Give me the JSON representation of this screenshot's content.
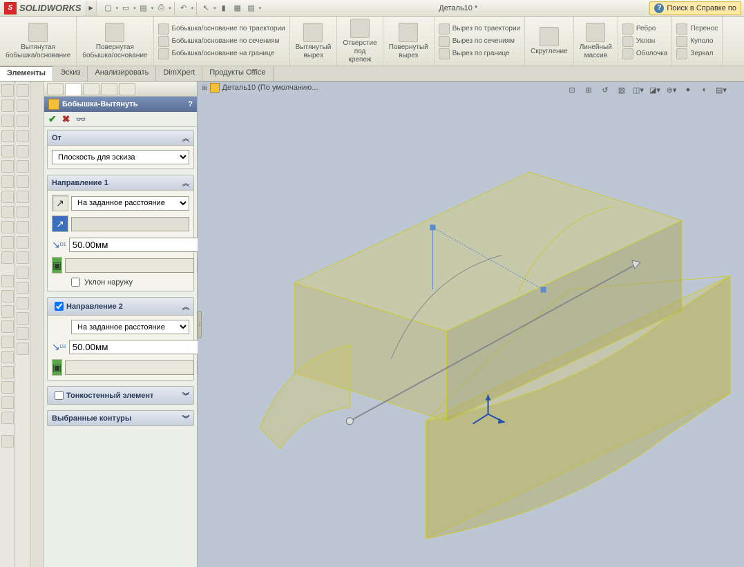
{
  "app": {
    "name": "SOLIDWORKS",
    "doc_title": "Деталь10 *",
    "help_search": "Поиск в Справке по"
  },
  "ribbon": {
    "extrude_boss": "Вытянутая\nбобышка/основание",
    "revolve_boss": "Повернутая\nбобышка/основание",
    "sweep": "Бобышка/основание по траектории",
    "loft": "Бобышка/основание по сечениям",
    "boundary": "Бобышка/основание на границе",
    "extrude_cut": "Вытянутый\nвырез",
    "hole": "Отверстие\nпод\nкрепеж",
    "revolve_cut": "Повернутый\nвырез",
    "sweep_cut": "Вырез по траектории",
    "loft_cut": "Вырез по сечениям",
    "boundary_cut": "Вырез по границе",
    "fillet": "Скругление",
    "pattern": "Линейный\nмассив",
    "rib": "Ребро",
    "draft": "Уклон",
    "shell": "Оболочка",
    "wrap": "Перенос",
    "dome": "Куполо",
    "mirror": "Зеркал"
  },
  "tabs": {
    "features": "Элементы",
    "sketch": "Эскиз",
    "evaluate": "Анализировать",
    "dimxpert": "DimXpert",
    "office": "Продукты Office"
  },
  "pm": {
    "title": "Бобышка-Вытянуть",
    "from": "От",
    "from_opt": "Плоскость для эскиза",
    "dir1": "Направление 1",
    "dir2": "Направление 2",
    "end_cond": "На заданное расстояние",
    "d1": "50.00мм",
    "d2": "50.00мм",
    "draft_out": "Уклон наружу",
    "thin": "Тонкостенный элемент",
    "contours": "Выбранные контуры"
  },
  "tree": {
    "node": "Деталь10  (По умолчанию..."
  }
}
